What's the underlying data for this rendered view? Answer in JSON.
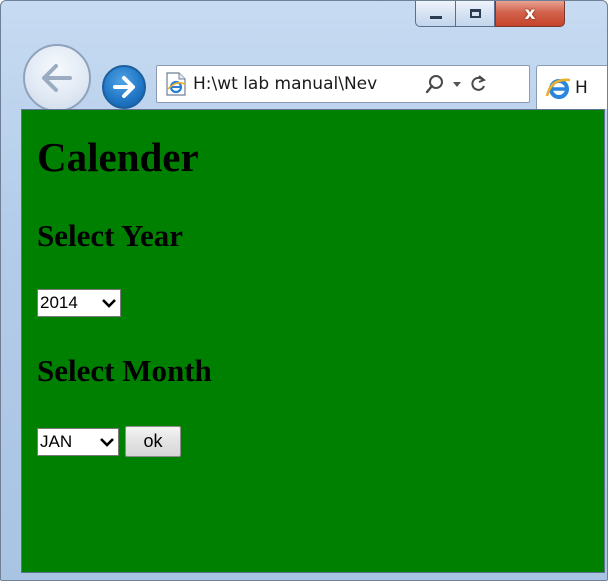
{
  "browser": {
    "address": "H:\\wt lab manual\\Nev",
    "tab_label": "H",
    "close_glyph": "x"
  },
  "page": {
    "heading": "Calender",
    "year_label": "Select Year",
    "year_selected": "2014",
    "month_label": "Select Month",
    "month_selected": "JAN",
    "ok_label": "ok",
    "background_color": "#008000"
  }
}
